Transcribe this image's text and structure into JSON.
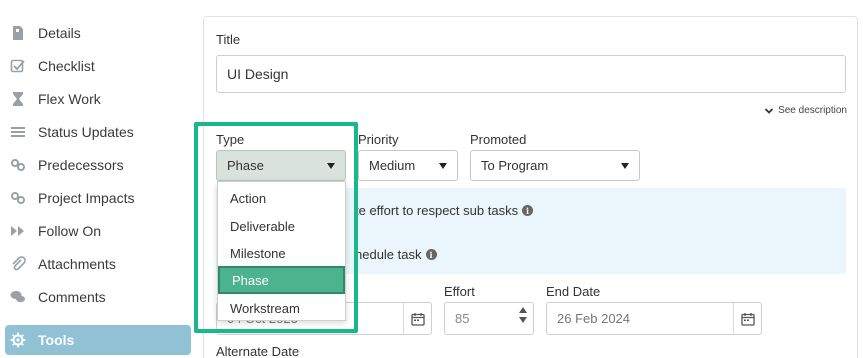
{
  "sidebar": {
    "items": [
      {
        "label": "Details",
        "icon": "document-icon"
      },
      {
        "label": "Checklist",
        "icon": "checkbox-icon"
      },
      {
        "label": "Flex Work",
        "icon": "hourglass-icon"
      },
      {
        "label": "Status Updates",
        "icon": "list-icon"
      },
      {
        "label": "Predecessors",
        "icon": "link-icon"
      },
      {
        "label": "Project Impacts",
        "icon": "link-icon"
      },
      {
        "label": "Follow On",
        "icon": "fast-forward-icon"
      },
      {
        "label": "Attachments",
        "icon": "paperclip-icon"
      },
      {
        "label": "Comments",
        "icon": "comments-icon"
      },
      {
        "label": "Tools",
        "icon": "gear-icon",
        "active": true
      }
    ]
  },
  "form": {
    "title_label": "Title",
    "title_value": "UI Design",
    "see_description": "See description",
    "type_label": "Type",
    "type_value": "Phase",
    "priority_label": "Priority",
    "priority_value": "Medium",
    "promoted_label": "Promoted",
    "promoted_value": "To Program",
    "info_line1": "te effort to respect sub tasks",
    "info_line2": "hedule task",
    "start_date_value": "04 Oct 2023",
    "effort_label": "Effort",
    "effort_value": "85",
    "end_date_label": "End Date",
    "end_date_value": "26 Feb 2024",
    "alternate_date_label": "Alternate Date"
  },
  "type_dropdown": {
    "options": [
      "Action",
      "Deliverable",
      "Milestone",
      "Phase",
      "Workstream"
    ],
    "selected": "Phase"
  },
  "colors": {
    "sidebar_active": "#91c1d4",
    "highlight": "#19b88a",
    "selected_option": "#4db38f",
    "info_box": "#eaf6fb"
  }
}
